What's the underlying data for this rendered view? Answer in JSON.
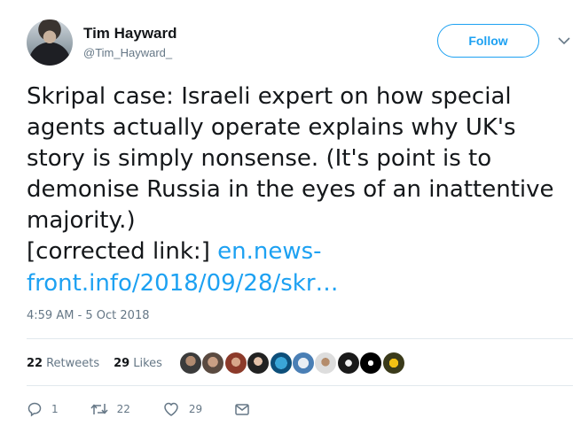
{
  "author": {
    "name": "Tim Hayward",
    "handle": "@Tim_Hayward_"
  },
  "follow_label": "Follow",
  "tweet": {
    "text": "Skripal case: Israeli expert on how special agents actually operate explains why UK's story is simply nonsense. (It's point is to demonise Russia in the eyes of an inattentive majority.)",
    "link_prefix": "[corrected link:]",
    "link_text": "en.news-front.info/2018/09/28/skr…"
  },
  "timestamp": "4:59 AM - 5 Oct 2018",
  "stats": {
    "retweets_count": "22",
    "retweets_label": "Retweets",
    "likes_count": "29",
    "likes_label": "Likes"
  },
  "actions": {
    "reply_count": "1",
    "retweet_count": "22",
    "like_count": "29"
  },
  "colors": {
    "accent": "#1da1f2",
    "secondary_text": "#657786",
    "divider": "#e1e8ed"
  }
}
